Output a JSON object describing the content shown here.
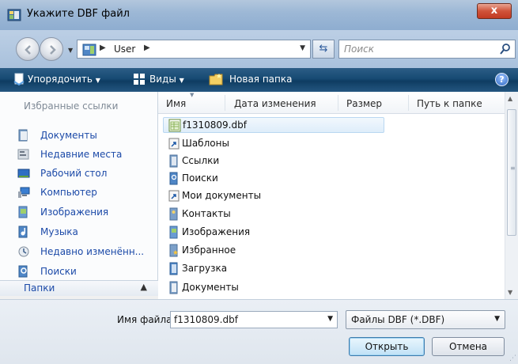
{
  "window": {
    "title": "Укажите DBF файл",
    "close_label": "x"
  },
  "address": {
    "path_segment": "User",
    "search_placeholder": "Поиск"
  },
  "toolbar": {
    "organize_label": "Упорядочить",
    "views_label": "Виды",
    "new_folder_label": "Новая папка",
    "help_label": "?"
  },
  "nav": {
    "header": "Избранные ссылки",
    "links": [
      {
        "label": "Документы",
        "icon": "documents-icon"
      },
      {
        "label": "Недавние места",
        "icon": "recent-places-icon"
      },
      {
        "label": "Рабочий стол",
        "icon": "desktop-icon"
      },
      {
        "label": "Компьютер",
        "icon": "computer-icon"
      },
      {
        "label": "Изображения",
        "icon": "pictures-icon"
      },
      {
        "label": "Музыка",
        "icon": "music-icon"
      },
      {
        "label": "Недавно изменённ...",
        "icon": "recently-changed-icon"
      },
      {
        "label": "Поиски",
        "icon": "searches-icon"
      }
    ],
    "folders_label": "Папки"
  },
  "columns": {
    "name": "Имя",
    "date": "Дата изменения",
    "size": "Размер",
    "path": "Путь к папке"
  },
  "files": [
    {
      "name": "f1310809.dbf",
      "icon": "dbf-file-icon",
      "selected": true
    },
    {
      "name": "Шаблоны",
      "icon": "shortcut-icon"
    },
    {
      "name": "Ссылки",
      "icon": "folder-icon"
    },
    {
      "name": "Поиски",
      "icon": "searches-folder-icon"
    },
    {
      "name": "Мои документы",
      "icon": "shortcut-icon"
    },
    {
      "name": "Контакты",
      "icon": "contacts-folder-icon"
    },
    {
      "name": "Изображения",
      "icon": "pictures-folder-icon"
    },
    {
      "name": "Избранное",
      "icon": "favorites-folder-icon"
    },
    {
      "name": "Загрузка",
      "icon": "folder-icon"
    },
    {
      "name": "Документы",
      "icon": "documents-folder-icon"
    }
  ],
  "bottom": {
    "filename_label": "Имя файла:",
    "filename_value": "f1310809.dbf",
    "filetype_value": "Файлы DBF (*.DBF)",
    "open_label": "Открыть",
    "cancel_label": "Отмена"
  },
  "colors": {
    "toolbar": "#164a73",
    "link": "#1c4aa8",
    "selection": "#deedfa"
  }
}
